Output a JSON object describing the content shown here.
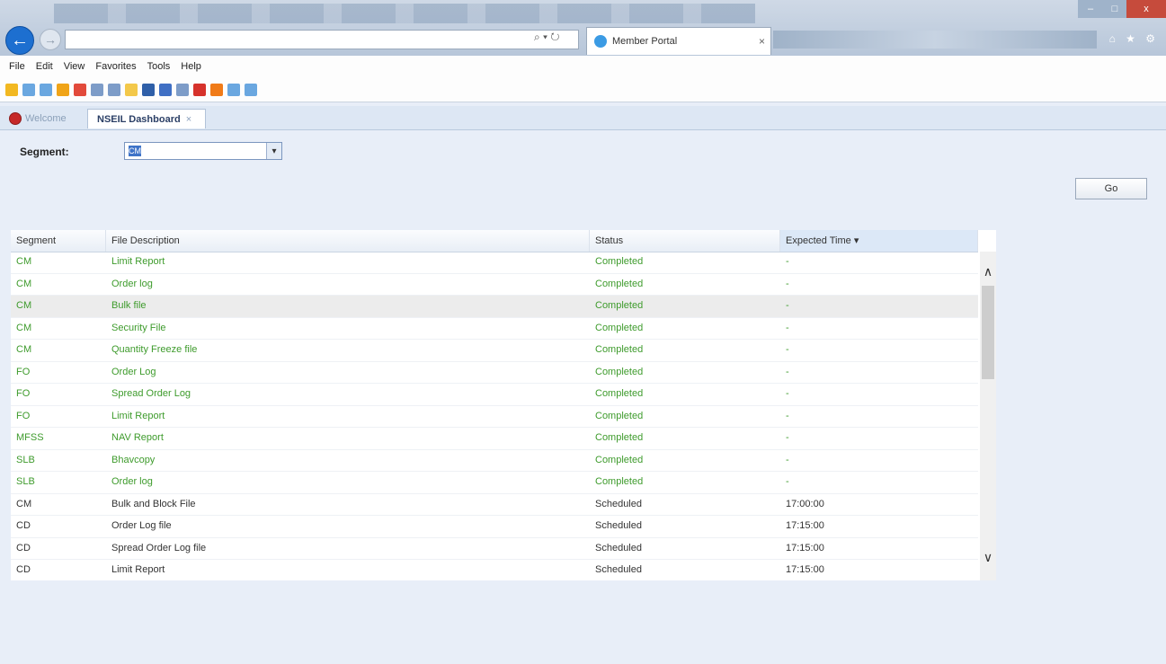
{
  "browser": {
    "tab_title": "Member Portal",
    "tab_close": "×",
    "address_icons": "⌕ ▾ ↻",
    "right_icons": "⌂ ★ ⚙",
    "window_buttons": {
      "min": "–",
      "max": "□",
      "close": "x"
    }
  },
  "menu": [
    "File",
    "Edit",
    "View",
    "Favorites",
    "Tools",
    "Help"
  ],
  "app_tabs": {
    "welcome": "Welcome",
    "dashboard": "NSEIL Dashboard",
    "dashboard_close": "×"
  },
  "filter": {
    "label": "Segment:",
    "selected": "CM",
    "arrow": "▾"
  },
  "go_button": "Go",
  "grid": {
    "columns": [
      "Segment",
      "File Description",
      "Status",
      "Expected Time"
    ],
    "sort_indicator": "▾",
    "rows": [
      [
        "CM",
        "Limit Report",
        "Completed",
        "-"
      ],
      [
        "CM",
        "Order log",
        "Completed",
        "-"
      ],
      [
        "CM",
        "Bulk file",
        "Completed",
        "-"
      ],
      [
        "CM",
        "Security File",
        "Completed",
        "-"
      ],
      [
        "CM",
        "Quantity Freeze file",
        "Completed",
        "-"
      ],
      [
        "FO",
        "Order Log",
        "Completed",
        "-"
      ],
      [
        "FO",
        "Spread Order Log",
        "Completed",
        "-"
      ],
      [
        "FO",
        "Limit Report",
        "Completed",
        "-"
      ],
      [
        "MFSS",
        "NAV Report",
        "Completed",
        "-"
      ],
      [
        "SLB",
        "Bhavcopy",
        "Completed",
        "-"
      ],
      [
        "SLB",
        "Order log",
        "Completed",
        "-"
      ],
      [
        "CM",
        "Bulk and Block File",
        "Scheduled",
        "17:00:00"
      ],
      [
        "CD",
        "Order Log file",
        "Scheduled",
        "17:15:00"
      ],
      [
        "CD",
        "Spread Order Log file",
        "Scheduled",
        "17:15:00"
      ],
      [
        "CD",
        "Limit Report",
        "Scheduled",
        "17:15:00"
      ]
    ]
  },
  "scroll": {
    "up": "∧",
    "down": "∨"
  },
  "colors": {
    "completed": "#3e9b2c",
    "scheduled": "#333333",
    "accent": "#1d6fd0"
  }
}
